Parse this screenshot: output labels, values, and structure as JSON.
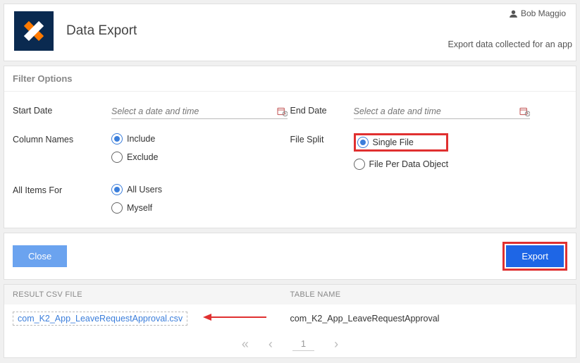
{
  "user": {
    "name": "Bob Maggio"
  },
  "header": {
    "title": "Data Export",
    "subtitle": "Export data collected for an app"
  },
  "filter": {
    "section_label": "Filter Options",
    "start_date": {
      "label": "Start Date",
      "placeholder": "Select a date and time"
    },
    "end_date": {
      "label": "End Date",
      "placeholder": "Select a date and time"
    },
    "column_names": {
      "label": "Column Names",
      "options": {
        "include": "Include",
        "exclude": "Exclude"
      }
    },
    "file_split": {
      "label": "File Split",
      "options": {
        "single": "Single File",
        "per_object": "File Per Data Object"
      }
    },
    "all_items": {
      "label": "All Items For",
      "options": {
        "all_users": "All Users",
        "myself": "Myself"
      }
    }
  },
  "actions": {
    "close": "Close",
    "export": "Export"
  },
  "results": {
    "headers": {
      "file": "RESULT CSV FILE",
      "table": "TABLE NAME"
    },
    "row": {
      "file": "com_K2_App_LeaveRequestApproval.csv",
      "table": "com_K2_App_LeaveRequestApproval"
    },
    "page": "1"
  }
}
